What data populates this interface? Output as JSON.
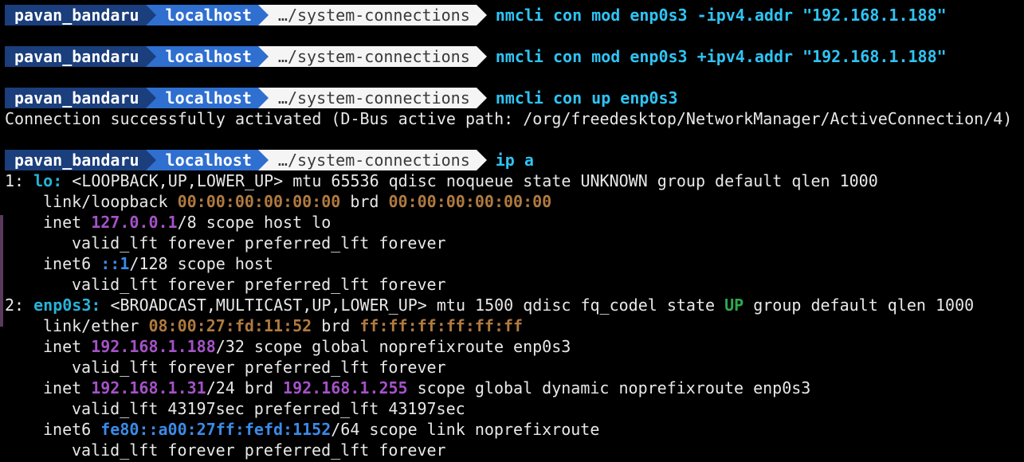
{
  "prompt": {
    "user": "pavan_bandaru",
    "host": "localhost",
    "path": "…/system-connections"
  },
  "commands": {
    "c1": "nmcli con mod enp0s3 -ipv4.addr \"192.168.1.188\"",
    "c2": "nmcli con mod enp0s3 +ipv4.addr \"192.168.1.188\"",
    "c3": "nmcli con up enp0s3",
    "c4": "ip a"
  },
  "output": {
    "activated": "Connection successfully activated (D-Bus active path: /org/freedesktop/NetworkManager/ActiveConnection/4)",
    "lo": {
      "num": "1: ",
      "name": "lo:",
      "flags": " <LOOPBACK,UP,LOWER_UP> mtu 65536 qdisc noqueue state UNKNOWN group default qlen 1000",
      "link_prefix": "link/loopback ",
      "mac": "00:00:00:00:00:00",
      "brd_label": " brd ",
      "brd": "00:00:00:00:00:00",
      "inet_prefix": "inet ",
      "inet": "127.0.0.1",
      "inet_suffix": "/8 scope host lo",
      "valid1": "valid_lft forever preferred_lft forever",
      "inet6_prefix": "inet6 ",
      "inet6": "::1",
      "inet6_suffix": "/128 scope host",
      "valid2": "valid_lft forever preferred_lft forever"
    },
    "enp": {
      "num": "2: ",
      "name": "enp0s3:",
      "flags": " <BROADCAST,MULTICAST,UP,LOWER_UP> mtu 1500 qdisc fq_codel state ",
      "state": "UP",
      "flags_tail": " group default qlen 1000",
      "link_prefix": "link/ether ",
      "mac": "08:00:27:fd:11:52",
      "brd_label": " brd ",
      "brd": "ff:ff:ff:ff:ff:ff",
      "inet_prefix_a": "inet ",
      "inet_a": "192.168.1.188",
      "inet_suffix_a": "/32 scope global noprefixroute enp0s3",
      "valid_a": "valid_lft forever preferred_lft forever",
      "inet_prefix_b": "inet ",
      "inet_b": "192.168.1.31",
      "inet_mid_b": "/24 brd ",
      "brd_b": "192.168.1.255",
      "inet_suffix_b": " scope global dynamic noprefixroute enp0s3",
      "valid_b": "valid_lft 43197sec preferred_lft 43197sec",
      "inet6_prefix": "inet6 ",
      "inet6": "fe80::a00:27ff:fefd:1152",
      "inet6_suffix": "/64 scope link noprefixroute",
      "valid_c": "valid_lft forever preferred_lft forever"
    }
  },
  "colors": {
    "background": "#000000",
    "command": "#2ec4f5",
    "ip_address": "#a552c8",
    "mac_address": "#b07a3f",
    "ipv6": "#3b8be8",
    "state_up": "#2fa84f"
  }
}
